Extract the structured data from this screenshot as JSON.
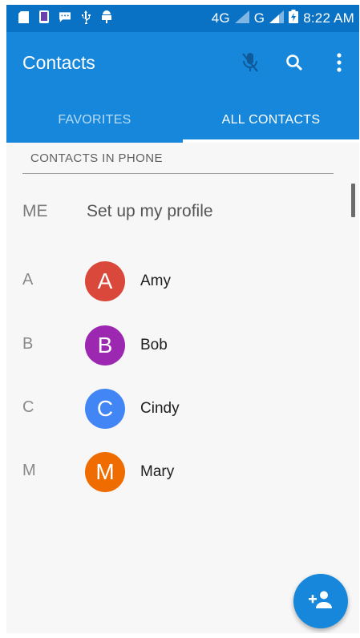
{
  "status_bar": {
    "network_4g": "4G",
    "network_g": "G",
    "time": "8:22 AM",
    "left_icons": [
      "sd-card-icon",
      "phone-icon",
      "message-icon",
      "usb-icon",
      "android-debug-icon"
    ]
  },
  "app_bar": {
    "title": "Contacts",
    "icons": [
      "mic-off-icon",
      "search-icon",
      "more-vert-icon"
    ]
  },
  "tabs": [
    {
      "label": "FAVORITES",
      "active": false
    },
    {
      "label": "ALL CONTACTS",
      "active": true
    }
  ],
  "list": {
    "section_header": "CONTACTS IN PHONE",
    "me": {
      "label": "ME",
      "text": "Set up my profile"
    },
    "contacts": [
      {
        "letter": "A",
        "initial": "A",
        "name": "Amy",
        "color": "#d9483b"
      },
      {
        "letter": "B",
        "initial": "B",
        "name": "Bob",
        "color": "#9c27b0"
      },
      {
        "letter": "C",
        "initial": "C",
        "name": "Cindy",
        "color": "#4285f4"
      },
      {
        "letter": "M",
        "initial": "M",
        "name": "Mary",
        "color": "#ef6c00"
      }
    ]
  },
  "fab": {
    "icon": "add-contact-icon"
  },
  "colors": {
    "status_bar": "#0a72c4",
    "app_bar": "#1787db",
    "background": "#f7f7f7"
  }
}
